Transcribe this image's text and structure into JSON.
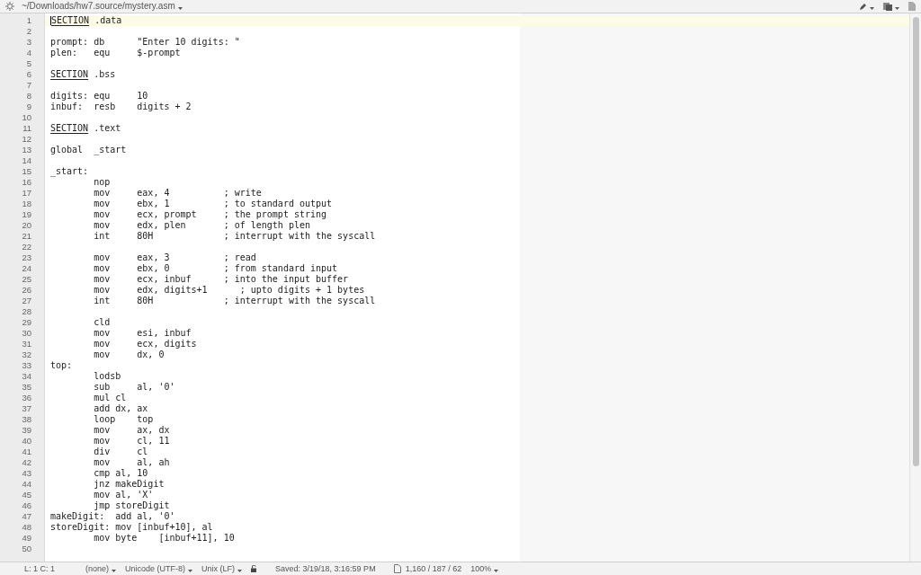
{
  "title_bar": {
    "path": "~/Downloads/hw7.source/mystery.asm"
  },
  "lines": [
    {
      "n": "1",
      "kind": "section",
      "keyword": "SECTION",
      "rest": " .data",
      "current": true
    },
    {
      "n": "2",
      "kind": "plain",
      "current": false
    },
    {
      "n": "3",
      "kind": "plain",
      "text": "prompt: db      \"Enter 10 digits: \"",
      "current": false
    },
    {
      "n": "4",
      "kind": "plain",
      "text": "plen:   equ     $-prompt",
      "current": false
    },
    {
      "n": "5",
      "kind": "plain",
      "current": false
    },
    {
      "n": "6",
      "kind": "section",
      "keyword": "SECTION",
      "rest": " .bss",
      "current": false
    },
    {
      "n": "7",
      "kind": "plain",
      "current": false
    },
    {
      "n": "8",
      "kind": "plain",
      "text": "digits: equ     10",
      "current": false
    },
    {
      "n": "9",
      "kind": "plain",
      "text": "inbuf:  resb    digits + 2",
      "current": false
    },
    {
      "n": "10",
      "kind": "plain",
      "current": false
    },
    {
      "n": "11",
      "kind": "section",
      "keyword": "SECTION",
      "rest": " .text",
      "current": false
    },
    {
      "n": "12",
      "kind": "plain",
      "current": false
    },
    {
      "n": "13",
      "kind": "plain",
      "text": "global  _start",
      "current": false
    },
    {
      "n": "14",
      "kind": "plain",
      "current": false
    },
    {
      "n": "15",
      "kind": "plain",
      "text": "_start:",
      "current": false
    },
    {
      "n": "16",
      "kind": "plain",
      "text": "        nop",
      "current": false
    },
    {
      "n": "17",
      "kind": "plain",
      "text": "        mov     eax, 4          ; write",
      "current": false
    },
    {
      "n": "18",
      "kind": "plain",
      "text": "        mov     ebx, 1          ; to standard output",
      "current": false
    },
    {
      "n": "19",
      "kind": "plain",
      "text": "        mov     ecx, prompt     ; the prompt string",
      "current": false
    },
    {
      "n": "20",
      "kind": "plain",
      "text": "        mov     edx, plen       ; of length plen",
      "current": false
    },
    {
      "n": "21",
      "kind": "plain",
      "text": "        int     80H             ; interrupt with the syscall",
      "current": false
    },
    {
      "n": "22",
      "kind": "plain",
      "current": false
    },
    {
      "n": "23",
      "kind": "plain",
      "text": "        mov     eax, 3          ; read",
      "current": false
    },
    {
      "n": "24",
      "kind": "plain",
      "text": "        mov     ebx, 0          ; from standard input",
      "current": false
    },
    {
      "n": "25",
      "kind": "plain",
      "text": "        mov     ecx, inbuf      ; into the input buffer",
      "current": false
    },
    {
      "n": "26",
      "kind": "plain",
      "text": "        mov     edx, digits+1      ; upto digits + 1 bytes",
      "current": false
    },
    {
      "n": "27",
      "kind": "plain",
      "text": "        int     80H             ; interrupt with the syscall",
      "current": false
    },
    {
      "n": "28",
      "kind": "plain",
      "current": false
    },
    {
      "n": "29",
      "kind": "plain",
      "text": "        cld",
      "current": false
    },
    {
      "n": "30",
      "kind": "plain",
      "text": "        mov     esi, inbuf",
      "current": false
    },
    {
      "n": "31",
      "kind": "plain",
      "text": "        mov     ecx, digits",
      "current": false
    },
    {
      "n": "32",
      "kind": "plain",
      "text": "        mov     dx, 0",
      "current": false
    },
    {
      "n": "33",
      "kind": "plain",
      "text": "top:",
      "current": false
    },
    {
      "n": "34",
      "kind": "plain",
      "text": "        lodsb",
      "current": false
    },
    {
      "n": "35",
      "kind": "plain",
      "text": "        sub     al, '0'",
      "current": false
    },
    {
      "n": "36",
      "kind": "plain",
      "text": "        mul cl",
      "current": false
    },
    {
      "n": "37",
      "kind": "plain",
      "text": "        add dx, ax",
      "current": false
    },
    {
      "n": "38",
      "kind": "plain",
      "text": "        loop    top",
      "current": false
    },
    {
      "n": "39",
      "kind": "plain",
      "text": "        mov     ax, dx",
      "current": false
    },
    {
      "n": "40",
      "kind": "plain",
      "text": "        mov     cl, 11",
      "current": false
    },
    {
      "n": "41",
      "kind": "plain",
      "text": "        div     cl",
      "current": false
    },
    {
      "n": "42",
      "kind": "plain",
      "text": "        mov     al, ah",
      "current": false
    },
    {
      "n": "43",
      "kind": "plain",
      "text": "        cmp al, 10",
      "current": false
    },
    {
      "n": "44",
      "kind": "plain",
      "text": "        jnz makeDigit",
      "current": false
    },
    {
      "n": "45",
      "kind": "plain",
      "text": "        mov al, 'X'",
      "current": false
    },
    {
      "n": "46",
      "kind": "plain",
      "text": "        jmp storeDigit",
      "current": false
    },
    {
      "n": "47",
      "kind": "plain",
      "text": "makeDigit:  add al, '0'",
      "current": false
    },
    {
      "n": "48",
      "kind": "plain",
      "text": "storeDigit: mov [inbuf+10], al",
      "current": false
    },
    {
      "n": "49",
      "kind": "plain",
      "text": "        mov byte    [inbuf+11], 10",
      "current": false
    },
    {
      "n": "50",
      "kind": "plain",
      "current": false
    }
  ],
  "status_bar": {
    "position": "L: 1 C: 1",
    "language": "(none)",
    "encoding": "Unicode (UTF-8)",
    "line_endings": "Unix (LF)",
    "saved": "Saved: 3/19/18, 3:16:59 PM",
    "counts": "1,160 / 187 / 62",
    "zoom": "100%"
  }
}
